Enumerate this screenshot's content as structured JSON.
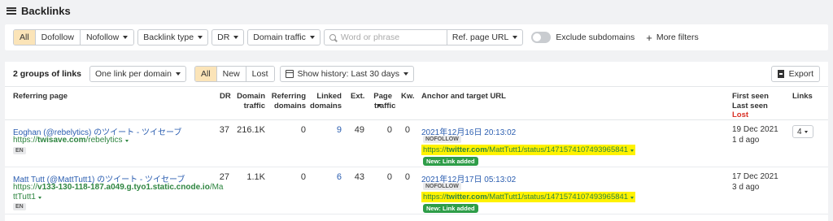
{
  "app": {
    "title": "Backlinks"
  },
  "filters": {
    "link_type_tabs": [
      "All",
      "Dofollow",
      "Nofollow"
    ],
    "active_link_type": "All",
    "backlink_type": "Backlink type",
    "dr": "DR",
    "domain_traffic": "Domain traffic",
    "search_placeholder": "Word or phrase",
    "search_scope": "Ref. page URL",
    "exclude_subdomains": "Exclude subdomains",
    "more_filters": "More filters"
  },
  "toolbar": {
    "groups_count": "2 groups of links",
    "grouping": "One link per domain",
    "state_tabs": [
      "All",
      "New",
      "Lost"
    ],
    "active_state": "All",
    "history": "Show history: Last 30 days",
    "export": "Export"
  },
  "table": {
    "headers": {
      "referring_page": "Referring page",
      "dr": "DR",
      "domain_traffic_1": "Domain",
      "domain_traffic_2": "traffic",
      "ref_domains_1": "Referring",
      "ref_domains_2": "domains",
      "linked_domains_1": "Linked",
      "linked_domains_2": "domains",
      "ext": "Ext.",
      "page_traffic_1": "Page",
      "page_traffic_2": "traffic",
      "kw": "Kw.",
      "anchor": "Anchor and target URL",
      "first_seen": "First seen",
      "last_seen": "Last seen",
      "lost": "Lost",
      "links": "Links"
    },
    "rows": [
      {
        "title": "Eoghan (@rebelytics) のツイート - ツイセーブ",
        "url_prefix": "https://",
        "url_domain": "twisave.com",
        "url_path": "/rebelytics",
        "lang": "EN",
        "dr": "37",
        "domain_traffic": "216.1K",
        "referring_domains": "0",
        "linked_domains": "9",
        "ext": "49",
        "page_traffic": "0",
        "kw": "0",
        "anchor_date": "2021年12月16日 20:13:02",
        "nofollow": "NOFOLLOW",
        "target_prefix": "https://",
        "target_domain": "twitter.com",
        "target_path": "/MattTutt1/status/1471574107493965841",
        "badge": "New: Link added",
        "first_seen": "19 Dec 2021",
        "last_seen": "1 d ago",
        "links": "4"
      },
      {
        "title": "Matt Tutt (@MattTutt1) のツイート - ツイセーブ",
        "url_prefix": "https://",
        "url_domain": "v133-130-118-187.a049.g.tyo1.static.cnode.io",
        "url_path_1": "/Ma",
        "url_path_2": "ttTutt1",
        "lang": "EN",
        "dr": "27",
        "domain_traffic": "1.1K",
        "referring_domains": "0",
        "linked_domains": "6",
        "ext": "43",
        "page_traffic": "0",
        "kw": "0",
        "anchor_date": "2021年12月17日 05:13:02",
        "nofollow": "NOFOLLOW",
        "target_prefix": "https://",
        "target_domain": "twitter.com",
        "target_path": "/MattTutt1/status/1471574107493965841",
        "badge": "New: Link added",
        "first_seen": "17 Dec 2021",
        "last_seen": "3 d ago"
      }
    ]
  },
  "colors": {
    "active_tab": "#fbe4b8",
    "link": "#2a5db0",
    "url_green": "#2e8540",
    "highlight": "#fff200",
    "new_badge": "#2e9d48",
    "lost": "#d93025"
  }
}
